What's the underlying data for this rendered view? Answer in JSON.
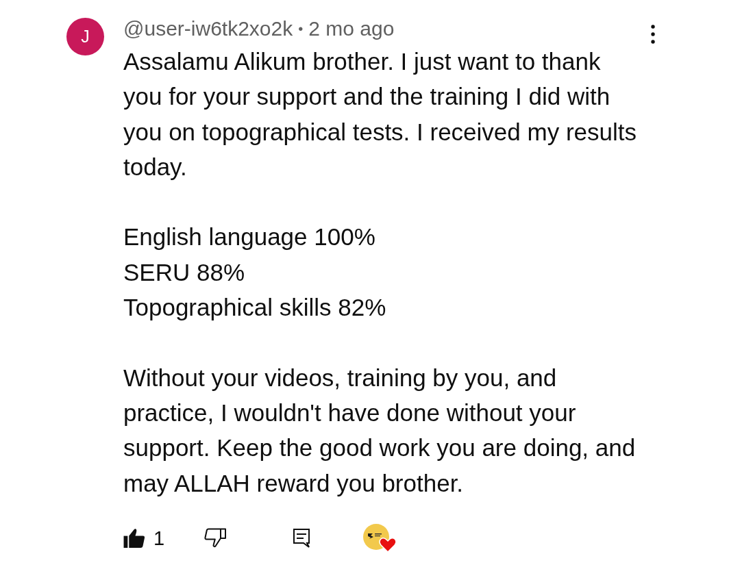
{
  "comment": {
    "avatar_letter": "J",
    "author": "@user-iw6tk2xo2k",
    "separator": "•",
    "time": "2 mo ago",
    "paragraphs": [
      "Assalamu Alikum brother. I just want to thank you for your support and the training I did with you on topographical tests. I received my results today.",
      "English language 100%\nSERU 88%\nTopographical skills 82%",
      "Without your videos, training by you, and practice, I wouldn't have done without your support. Keep the good work you are doing, and may ALLAH reward you brother."
    ]
  },
  "actions": {
    "liked": true,
    "like_count": "1",
    "disliked": false,
    "creator_heart": true
  }
}
